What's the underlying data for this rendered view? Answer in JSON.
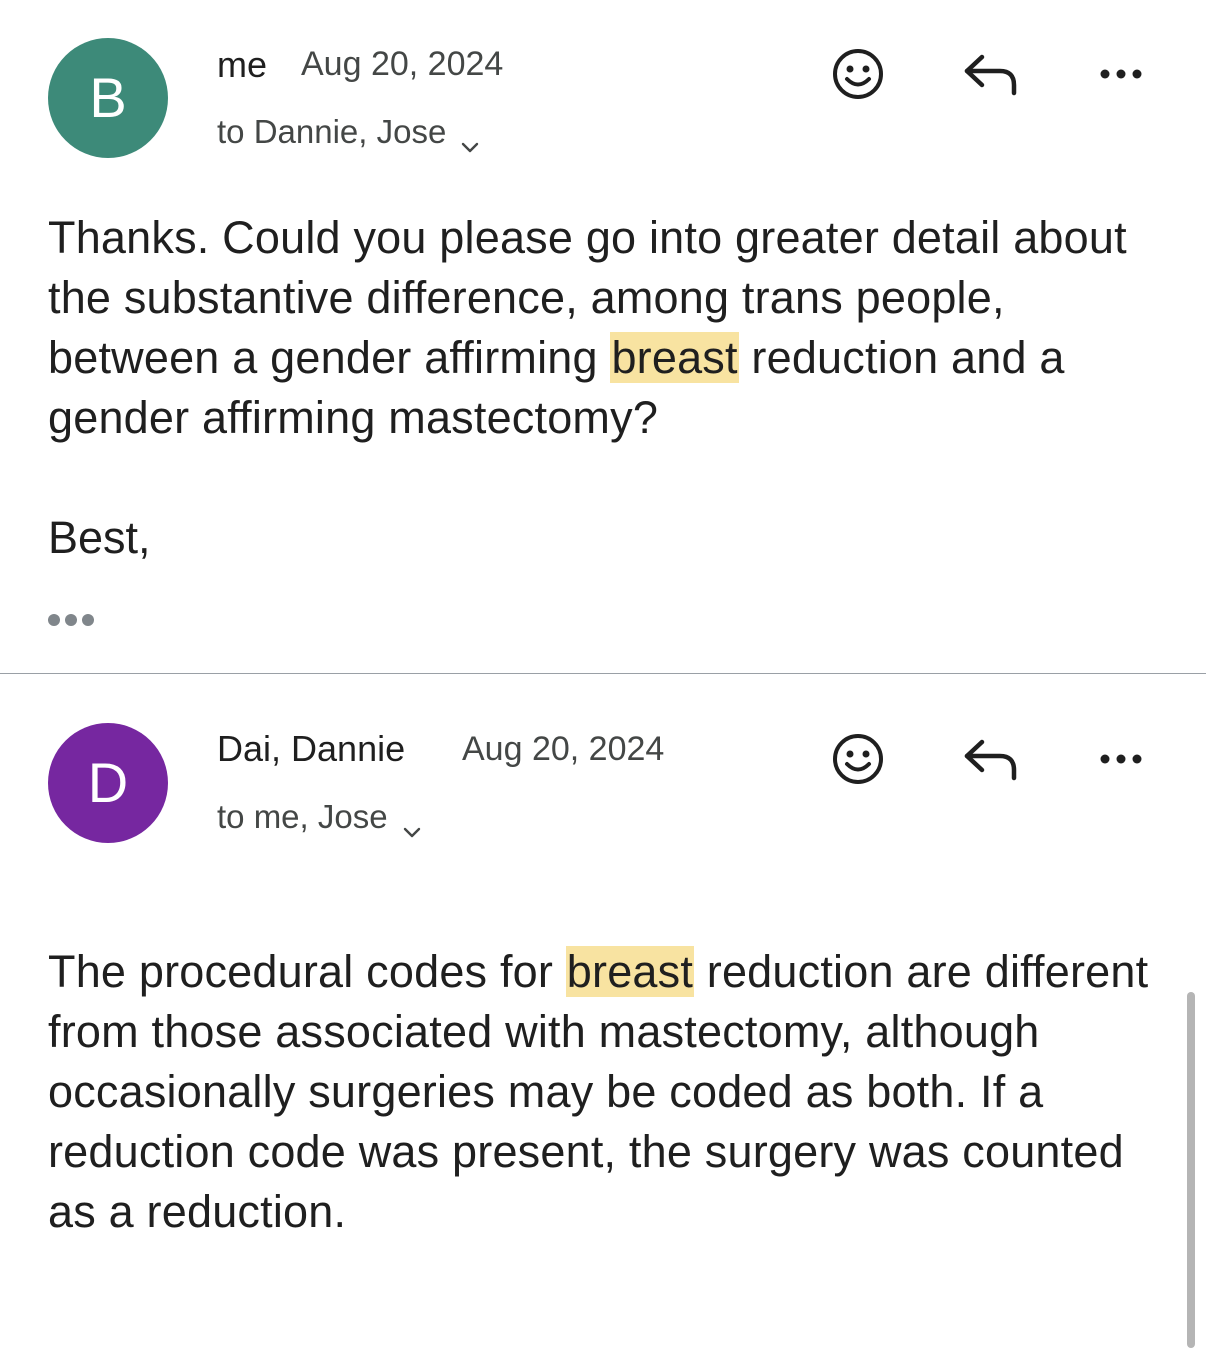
{
  "messages": [
    {
      "avatar": {
        "initial": "B",
        "color": "#3d8a79"
      },
      "sender": "me",
      "date": "Aug 20, 2024",
      "recipients": "to Dannie, Jose",
      "body": {
        "pre": "Thanks. Could you please go into greater detail about the substantive difference, among trans people, between a gender affirming ",
        "highlight": "breast",
        "post": " reduction and a gender affirming mastectomy?"
      },
      "signoff": "Best,",
      "actions": [
        "smiley-icon",
        "reply-icon",
        "more-options-icon"
      ]
    },
    {
      "avatar": {
        "initial": "D",
        "color": "#7627a0"
      },
      "sender": "Dai, Dannie",
      "date": "Aug 20, 2024",
      "recipients": "to me, Jose",
      "body": {
        "pre": "The procedural codes for ",
        "highlight": "breast",
        "post": " reduction are different from those associated with mastectomy, although occasionally surgeries may be coded as both. If a reduction code was present, the surgery was counted as a reduction."
      },
      "actions": [
        "smiley-icon",
        "reply-icon",
        "more-options-icon"
      ]
    }
  ],
  "colors": {
    "highlight": "#f8e3a1",
    "text": "#1f1f1f",
    "secondary_text": "#444746"
  }
}
